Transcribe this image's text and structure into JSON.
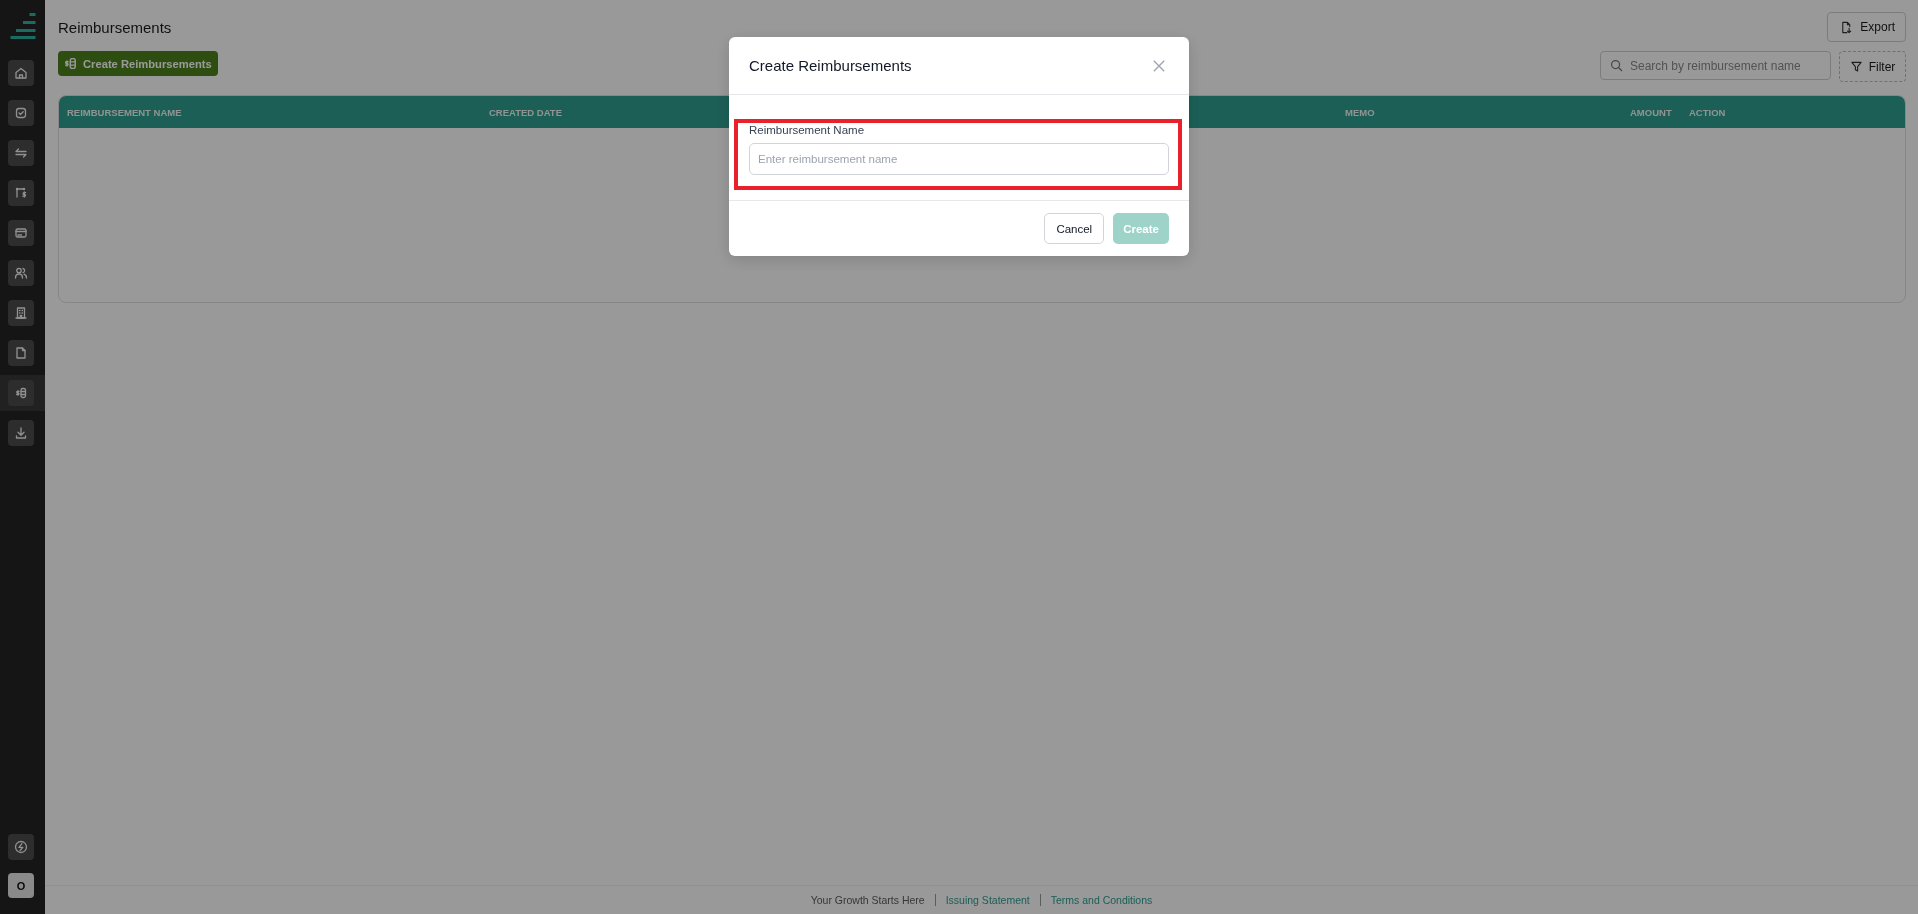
{
  "sidebar": {
    "items": [
      {
        "kind": "home",
        "selected": false
      },
      {
        "kind": "tasks",
        "selected": false
      },
      {
        "kind": "transfers",
        "selected": false
      },
      {
        "kind": "payouts",
        "selected": false
      },
      {
        "kind": "cards",
        "selected": false
      },
      {
        "kind": "people",
        "selected": false
      },
      {
        "kind": "company",
        "selected": false
      },
      {
        "kind": "documents",
        "selected": false
      },
      {
        "kind": "reimbursements",
        "selected": true
      },
      {
        "kind": "downloads",
        "selected": false
      }
    ],
    "bottom_items": [
      {
        "kind": "lightning"
      }
    ],
    "avatar": {
      "initial": "O"
    }
  },
  "header": {
    "title": "Reimbursements",
    "export_button": {
      "label": "Export"
    }
  },
  "toolbar": {
    "create_button": {
      "label": "Create Reimbursements"
    },
    "search": {
      "placeholder": "Search by reimbursement name"
    },
    "filter_button": {
      "label": "Filter"
    }
  },
  "table": {
    "columns": [
      {
        "label": "REIMBURSEMENT NAME"
      },
      {
        "label": "CREATED DATE"
      },
      {
        "label": "MEMO"
      },
      {
        "label": "AMOUNT"
      },
      {
        "label": "ACTION"
      }
    ]
  },
  "modal": {
    "title": "Create Reimbursements",
    "field": {
      "label": "Reimbursement Name",
      "placeholder": "Enter reimbursement name",
      "highlighted": true
    },
    "buttons": [
      {
        "kind": "cancel",
        "label": "Cancel",
        "disabled": false
      },
      {
        "kind": "create",
        "label": "Create",
        "disabled": true
      }
    ]
  },
  "footer": {
    "items": [
      {
        "kind": "text",
        "text": "Your Growth Starts Here"
      },
      {
        "kind": "link",
        "text": "Issuing Statement"
      },
      {
        "kind": "link",
        "text": "Terms and Conditions"
      }
    ]
  }
}
